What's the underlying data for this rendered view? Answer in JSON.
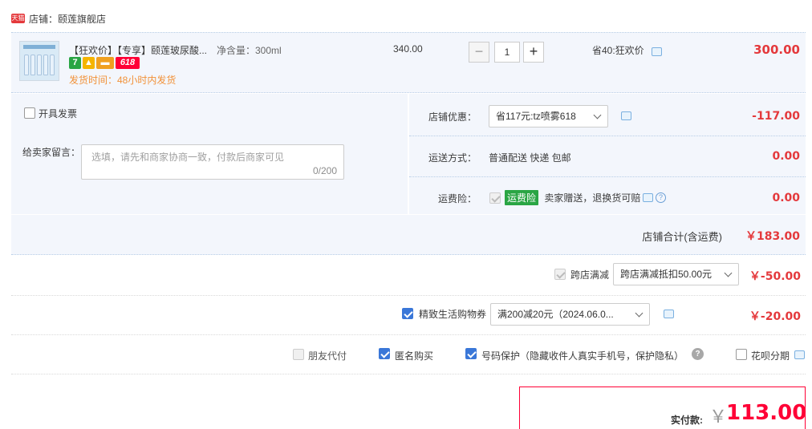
{
  "shop": {
    "badge": "天猫",
    "name": "店铺：颐莲旗舰店"
  },
  "product": {
    "title": "【狂欢价】【专享】颐莲玻尿酸...",
    "spec": "净含量：300ml",
    "tag_seven": "7",
    "tag_618": "618",
    "ship_time": "发货时间：48小时内发货",
    "unit_price": "340.00",
    "quantity": "1",
    "discount_note": "省40:狂欢价",
    "total": "300.00"
  },
  "invoice": {
    "label": "开具发票"
  },
  "message": {
    "label": "给卖家留言：",
    "placeholder": "选填，请先和商家协商一致，付款后商家可见",
    "count": "0/200"
  },
  "shop_discount": {
    "label": "店铺优惠：",
    "selected": "省117元:tz喷雾618",
    "value": "-117.00"
  },
  "shipping": {
    "label": "运送方式：",
    "method": "普通配送 快递 包邮",
    "value": "0.00"
  },
  "shipping_insurance": {
    "label": "运费险：",
    "badge": "运费险",
    "desc": "卖家赠送，退换货可赔",
    "value": "0.00"
  },
  "shop_subtotal": {
    "label": "店铺合计(含运费)",
    "value": "￥183.00"
  },
  "cross_shop": {
    "label": "跨店满减",
    "selected": "跨店满减抵扣50.00元",
    "value": "￥-50.00"
  },
  "coupon": {
    "label": "精致生活购物券",
    "selected": "满200减20元（2024.06.0...",
    "value": "￥-20.00"
  },
  "options": {
    "friend_pay": "朋友代付",
    "anonymous": "匿名购买",
    "number_protect": "号码保护（隐藏收件人真实手机号，保护隐私）",
    "help": "?",
    "huabei": "花呗分期"
  },
  "payment": {
    "label": "实付款:",
    "currency": "￥",
    "amount": "113.00"
  },
  "colors": {
    "accent_red": "#ff0036",
    "link_blue": "#3a77d8",
    "panel_bg": "#f3f6fc",
    "ship_orange": "#f29138",
    "badge_green": "#2aa544"
  },
  "icons": [
    "tmall-icon",
    "chat-icon",
    "help-icon",
    "chevron-down-icon",
    "plus-icon",
    "minus-icon"
  ]
}
